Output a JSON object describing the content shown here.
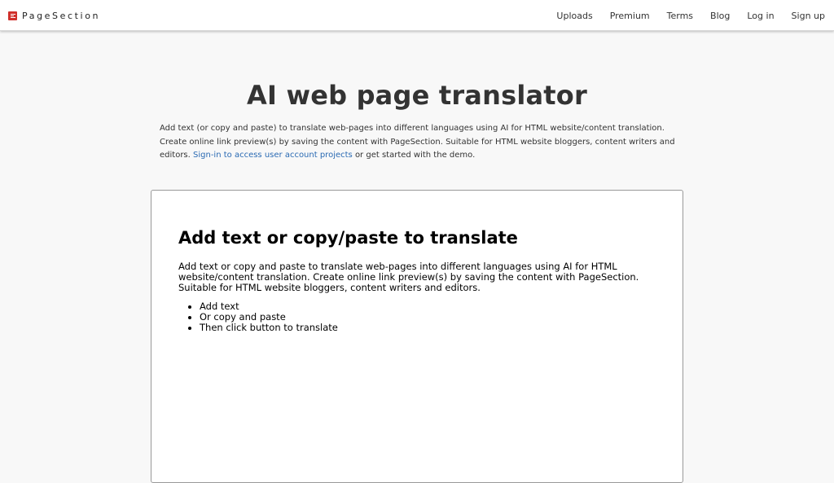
{
  "brand": {
    "name": "PageSection",
    "icon": "pagesection-logo-icon",
    "icon_color": "#d0302b"
  },
  "nav": [
    "Uploads",
    "Premium",
    "Terms",
    "Blog",
    "Log in",
    "Sign up"
  ],
  "hero": {
    "title": "AI web page translator",
    "intro_text": "Add text (or copy and paste) to translate web-pages into different languages using AI for HTML website/content translation. Create online link preview(s) by saving the content with PageSection. Suitable for HTML website bloggers, content writers and editors.",
    "intro_link": "Sign-in to access user account projects",
    "intro_suffix": "or get started with the demo.",
    "link_color": "#2a6ab3"
  },
  "editor": {
    "heading": "Add text or copy/paste to translate",
    "paragraph": "Add text or copy and paste to translate web-pages into different languages using AI for HTML website/content translation. Create online link preview(s) by saving the content with PageSection. Suitable for HTML website bloggers, content writers and editors.",
    "list": [
      "Add text",
      "Or copy and paste",
      "Then click button to translate"
    ]
  }
}
